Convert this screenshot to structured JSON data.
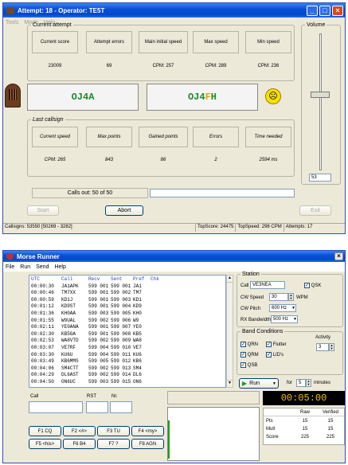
{
  "w1": {
    "title": "Attempt: 18 - Operator: TE5T",
    "menu": [
      "Tools",
      "Mode",
      "Help"
    ],
    "current_legend": "Current attempt",
    "cur_headers": [
      "Current score",
      "Attempt errors",
      "Main initial speed",
      "Max speed",
      "Min speed"
    ],
    "cur_values": [
      "23009",
      "69",
      "CPM: 257",
      "CPM: 289",
      "CPM: 236"
    ],
    "call_sent": "OJ4A",
    "call_recv_prefix": "OJ4",
    "call_recv_err": "F",
    "call_recv_suffix": "H",
    "volume_legend": "Volume",
    "volume_value": "53",
    "volume_level": 0.45,
    "last_legend": "Last callsign",
    "last_headers": [
      "Current speed",
      "Max points",
      "Gained points",
      "Errors",
      "Time needed"
    ],
    "last_values": [
      "CPM: 265",
      "843",
      "86",
      "2",
      "2594 ms"
    ],
    "calls_out": "Calls out: 50 of 50",
    "start": "Start",
    "abort": "Abort",
    "exit": "Exit",
    "status": [
      "Callsigns: 53550 [50269 - 3282]",
      "TopScore: 24475",
      "TopSpeed: 298 CPM",
      "Attempts: 17"
    ]
  },
  "w2": {
    "title": "Morse Runner",
    "menu": [
      "File",
      "Run",
      "Send",
      "Help"
    ],
    "log_headers": [
      "UTC",
      "Call",
      "Recv",
      "Sent",
      "Pref",
      "Chk"
    ],
    "log_rows": [
      [
        "00:00:30",
        "JA1APK",
        "599 001",
        "599 001",
        "JA1",
        ""
      ],
      [
        "00:00:46",
        "TM7XX",
        "599 001",
        "599 002",
        "TM7",
        ""
      ],
      [
        "00:00:59",
        "KD1J",
        "599 001",
        "599 003",
        "KD1",
        ""
      ],
      [
        "00:01:12",
        "KD9ST",
        "599 001",
        "599 004",
        "KD9",
        ""
      ],
      [
        "00:01:36",
        "KH0AA",
        "599 003",
        "599 005",
        "KH0",
        ""
      ],
      [
        "00:01:55",
        "W9UAL",
        "599 002",
        "599 006",
        "W9",
        ""
      ],
      [
        "00:02:11",
        "YE0ANA",
        "599 001",
        "599 007",
        "YE0",
        ""
      ],
      [
        "00:02:30",
        "KB5GA",
        "599 001",
        "599 008",
        "KB5",
        ""
      ],
      [
        "00:02:53",
        "WA8VTD",
        "599 002",
        "599 009",
        "WA8",
        ""
      ],
      [
        "00:03:07",
        "VE7RF",
        "599 004",
        "599 010",
        "VE7",
        ""
      ],
      [
        "00:03:30",
        "KU6U",
        "599 004",
        "599 011",
        "KU6",
        ""
      ],
      [
        "00:03:49",
        "KB6MMS",
        "599 005",
        "599 012",
        "KB6",
        ""
      ],
      [
        "00:04:06",
        "SM4CTT",
        "599 002",
        "599 013",
        "SM4",
        ""
      ],
      [
        "00:04:29",
        "DL6AST",
        "599 002",
        "599 014",
        "DL6",
        ""
      ],
      [
        "00:04:50",
        "ON6UC",
        "599 003",
        "599 015",
        "ON6",
        ""
      ]
    ],
    "station_legend": "Station",
    "call_label": "Call",
    "call_value": "VE3NEA",
    "qsk": "QSK",
    "cw_speed_label": "CW Speed",
    "cw_speed": "30",
    "wpm": "WPM",
    "cw_pitch_label": "CW Pitch",
    "cw_pitch": "600 Hz",
    "rx_bw_label": "RX Bandwidth",
    "rx_bw": "500 Hz",
    "band_legend": "Band Conditions",
    "qrn": "QRN",
    "flutter": "Flutter",
    "qrm": "QRM",
    "lids": "LID's",
    "qsb": "QSB",
    "activity_label": "Activity",
    "activity": "3",
    "run": "Run",
    "for_label": "for",
    "minutes_value": "5",
    "minutes": "minutes",
    "entry_call": "Call",
    "entry_rst": "RST",
    "entry_nr": "Nr.",
    "fkeys": [
      "F1 CQ",
      "F2 <#>",
      "F3 TU",
      "F4 <my>",
      "F5 <his>",
      "F6 B4",
      "F7 ?",
      "F8 AGN"
    ],
    "timer": "00:05:00",
    "score_headers": [
      "",
      "Raw",
      "Verified"
    ],
    "score_rows": [
      [
        "Pts",
        "15",
        "15"
      ],
      [
        "Mult",
        "15",
        "15"
      ],
      [
        "Score",
        "225",
        "225"
      ]
    ]
  }
}
